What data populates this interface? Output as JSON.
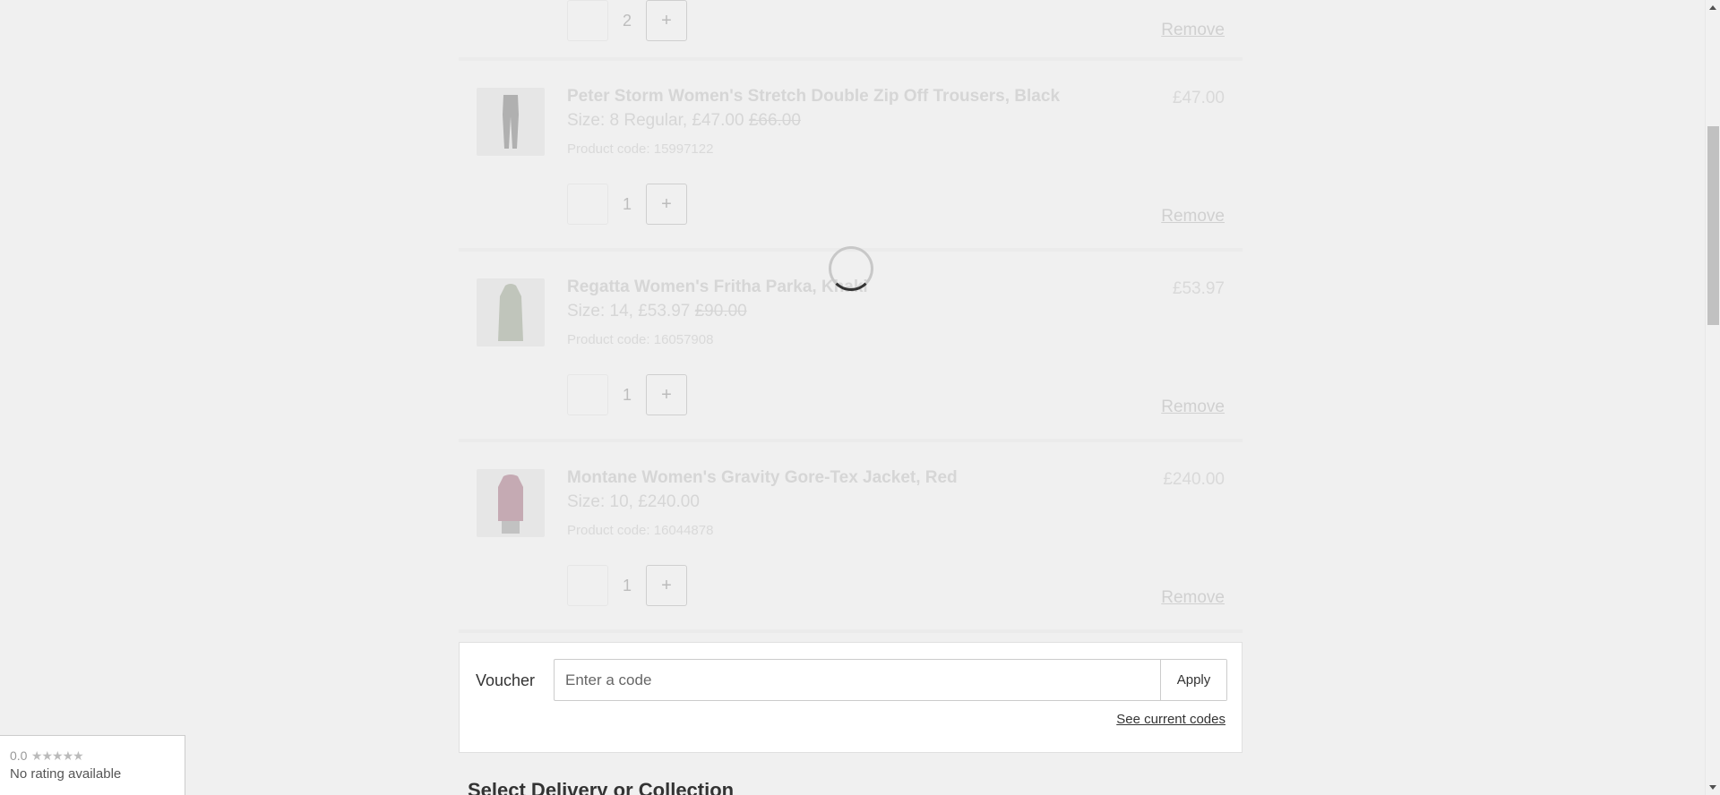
{
  "items": [
    {
      "quantity": "2",
      "plus_label": "+",
      "remove_label": "Remove"
    },
    {
      "name": "Peter Storm Women's Stretch Double Zip Off Trousers, Black",
      "size_text": "Size: 8 Regular, £47.00",
      "was_price": "£66.00",
      "product_code": "Product code: 15997122",
      "price": "£47.00",
      "quantity": "1",
      "plus_label": "+",
      "remove_label": "Remove"
    },
    {
      "name": "Regatta Women's Fritha Parka, Khaki",
      "size_text": "Size: 14, £53.97",
      "was_price": "£90.00",
      "product_code": "Product code: 16057908",
      "price": "£53.97",
      "quantity": "1",
      "plus_label": "+",
      "remove_label": "Remove"
    },
    {
      "name": "Montane Women's Gravity Gore-Tex Jacket, Red",
      "size_text": "Size: 10, £240.00",
      "was_price": "",
      "product_code": "Product code: 16044878",
      "price": "£240.00",
      "quantity": "1",
      "plus_label": "+",
      "remove_label": "Remove"
    }
  ],
  "voucher": {
    "label": "Voucher",
    "placeholder": "Enter a code",
    "apply_label": "Apply",
    "see_codes_label": "See current codes"
  },
  "delivery": {
    "heading": "Select Delivery or Collection"
  },
  "rating": {
    "score": "0.0",
    "stars": "★★★★★",
    "text": "No rating available"
  },
  "colors": {
    "page_background": "#f0f0f0",
    "overlay_text": "#d6d6d6",
    "panel_background": "#ffffff"
  }
}
